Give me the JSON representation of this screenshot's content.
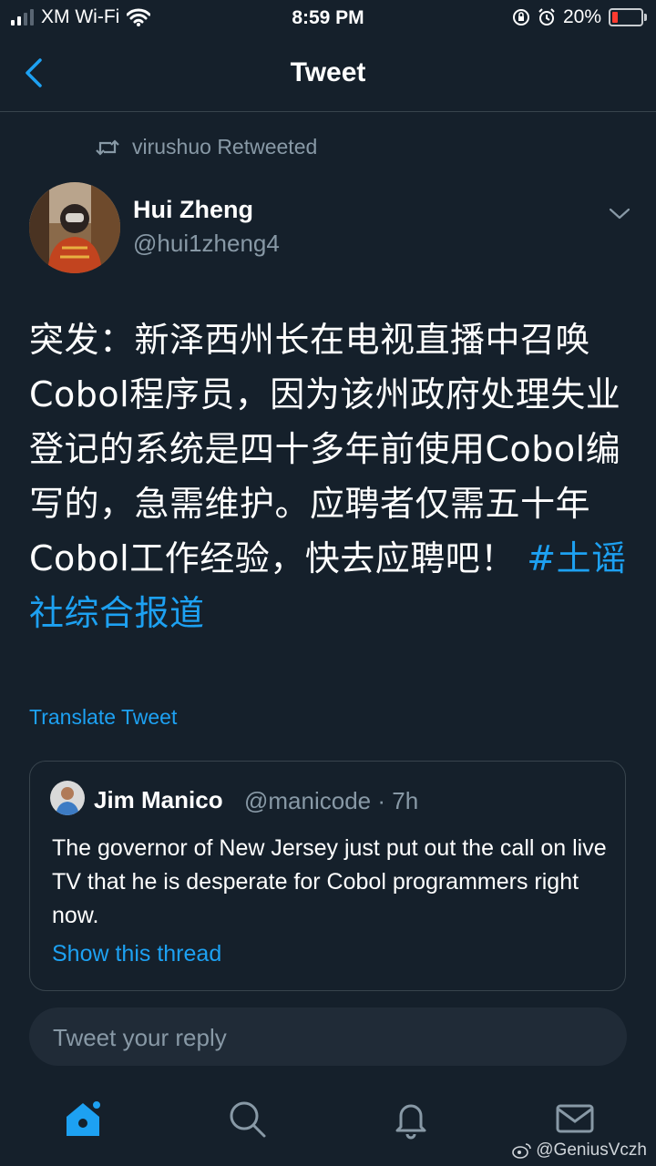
{
  "status_bar": {
    "carrier": "XM Wi-Fi",
    "time": "8:59 PM",
    "battery": "20%"
  },
  "header": {
    "title": "Tweet"
  },
  "retweet": {
    "text": "virushuo Retweeted"
  },
  "author": {
    "name": "Hui Zheng",
    "handle": "@hui1zheng4"
  },
  "tweet": {
    "text": "突发：新泽西州长在电视直播中召唤Cobol程序员，因为该州政府处理失业登记的系统是四十多年前使用Cobol编写的，急需维护。应聘者仅需五十年Cobol工作经验，快去应聘吧！ ",
    "hashtag": "#土谣社综合报道",
    "translate_label": "Translate Tweet"
  },
  "quote": {
    "name": "Jim Manico",
    "handle": "@manicode · 7h",
    "text": "The governor of New Jersey just put out the call on live TV that he is desperate for Cobol programmers right now.",
    "thread_label": "Show this thread"
  },
  "reply": {
    "placeholder": "Tweet your reply"
  },
  "tab_bar": {
    "tabs": [
      {
        "name": "home",
        "icon": "home-icon",
        "active": true
      },
      {
        "name": "search",
        "icon": "search-icon",
        "active": false
      },
      {
        "name": "notifications",
        "icon": "bell-icon",
        "active": false
      },
      {
        "name": "messages",
        "icon": "mail-icon",
        "active": false
      }
    ]
  },
  "watermark": {
    "text": "@GeniusVczh"
  },
  "colors": {
    "background": "#15202b",
    "accent": "#1da1f2",
    "secondary_text": "#8899a6",
    "border": "#38444d"
  }
}
